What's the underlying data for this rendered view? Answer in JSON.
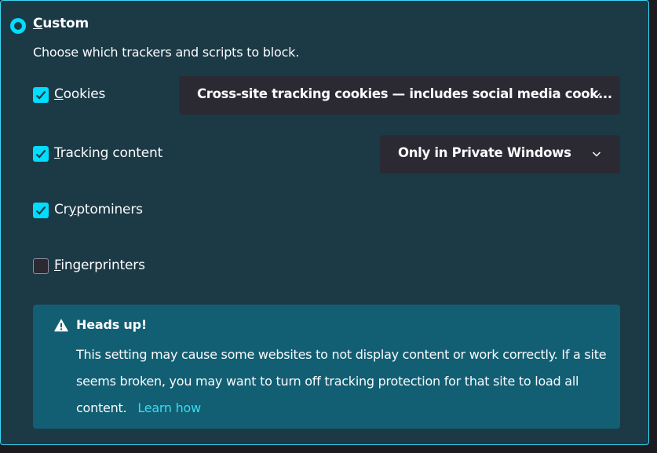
{
  "option": {
    "title": "Custom",
    "access_key": "C",
    "title_rest": "ustom",
    "selected": true,
    "description": "Choose which trackers and scripts to block."
  },
  "trackers": [
    {
      "label": "Cookies",
      "access_key": "C",
      "rest": "ookies",
      "checked": true,
      "select_value": "Cross-site tracking cookies — includes social media cook..."
    },
    {
      "label": "Tracking content",
      "access_key": "T",
      "rest": "racking content",
      "checked": true,
      "select_value": "Only in Private Windows"
    },
    {
      "label": "Cryptominers",
      "access_key": "y",
      "pre": "Cr",
      "rest": "ptominers",
      "checked": true
    },
    {
      "label": "Fingerprinters",
      "access_key": "F",
      "rest": "ingerprinters",
      "checked": false
    }
  ],
  "alert": {
    "heading": "Heads up!",
    "message": "This setting may cause some websites to not display content or work correctly. If a site seems broken, you may want to turn off tracking protection for that site to load all content.",
    "link": "Learn how"
  },
  "colors": {
    "accent": "#00ddff",
    "panel_bg": "#1b3a46",
    "alert_bg": "#125f73",
    "link": "#3adaf2"
  },
  "icons": [
    "radio-selected-icon",
    "checkbox-checked-icon",
    "checkbox-empty-icon",
    "chevron-down-icon",
    "warning-icon"
  ]
}
